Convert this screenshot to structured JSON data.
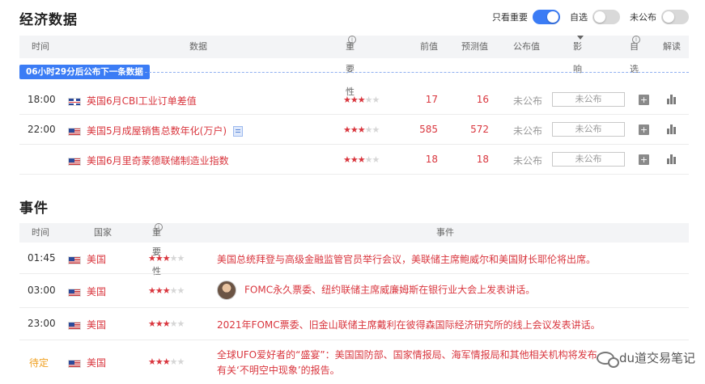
{
  "econ": {
    "title": "经济数据",
    "toggles": [
      {
        "label": "只看重要",
        "on": true
      },
      {
        "label": "自选",
        "on": false
      },
      {
        "label": "未公布",
        "on": false
      }
    ],
    "headers": {
      "time": "时间",
      "data": "数据",
      "importance": "重要性",
      "prev": "前值",
      "forecast": "预测值",
      "actual": "公布值",
      "impact": "影响",
      "watch": "自选",
      "read": "解读"
    },
    "countdown": "06小时29分后公布下一条数据",
    "rows": [
      {
        "time": "18:00",
        "flag": "uk",
        "name": "英国6月CBI工业订单差值",
        "stars": 3,
        "prev": "17",
        "forecast": "16",
        "actual": "未公布",
        "impact": "未公布",
        "doc": false
      },
      {
        "time": "22:00",
        "flag": "us",
        "name": "美国5月成屋销售总数年化(万户)",
        "stars": 3,
        "prev": "585",
        "forecast": "572",
        "actual": "未公布",
        "impact": "未公布",
        "doc": true
      },
      {
        "time": "",
        "flag": "us",
        "name": "美国6月里奇蒙德联储制造业指数",
        "stars": 3,
        "prev": "18",
        "forecast": "18",
        "actual": "未公布",
        "impact": "未公布",
        "doc": false
      }
    ]
  },
  "events": {
    "title": "事件",
    "headers": {
      "time": "时间",
      "country": "国家",
      "importance": "重要性",
      "event": "事件"
    },
    "rows": [
      {
        "time": "01:45",
        "pending": false,
        "flag": "us",
        "country": "美国",
        "stars": 3,
        "avatar": false,
        "text": "美国总统拜登与高级金融监管官员举行会议，美联储主席鲍威尔和美国财长耶伦将出席。",
        "text2": ""
      },
      {
        "time": "03:00",
        "pending": false,
        "flag": "us",
        "country": "美国",
        "stars": 3,
        "avatar": true,
        "text": "FOMC永久票委、纽约联储主席威廉姆斯在银行业大会上发表讲话。",
        "text2": ""
      },
      {
        "time": "23:00",
        "pending": false,
        "flag": "us",
        "country": "美国",
        "stars": 3,
        "avatar": false,
        "text": "2021年FOMC票委、旧金山联储主席戴利在彼得森国际经济研究所的线上会议发表讲话。",
        "text2": ""
      },
      {
        "time": "待定",
        "pending": true,
        "flag": "us",
        "country": "美国",
        "stars": 3,
        "avatar": false,
        "text": "全球UFO爱好者的“盛宴”：美国国防部、国家情报局、海军情报局和其他相关机构将发布",
        "text2": "有关‘不明空中现象’的报告。"
      }
    ]
  },
  "watermark": "du道交易笔记",
  "icons": {
    "info": "info-icon",
    "caret": "caret-down-icon",
    "add": "plus-square-icon",
    "chart": "bar-chart-icon"
  },
  "colors": {
    "accent": "#3b7cf5",
    "red": "#d9363e",
    "pending": "#f0a020"
  }
}
